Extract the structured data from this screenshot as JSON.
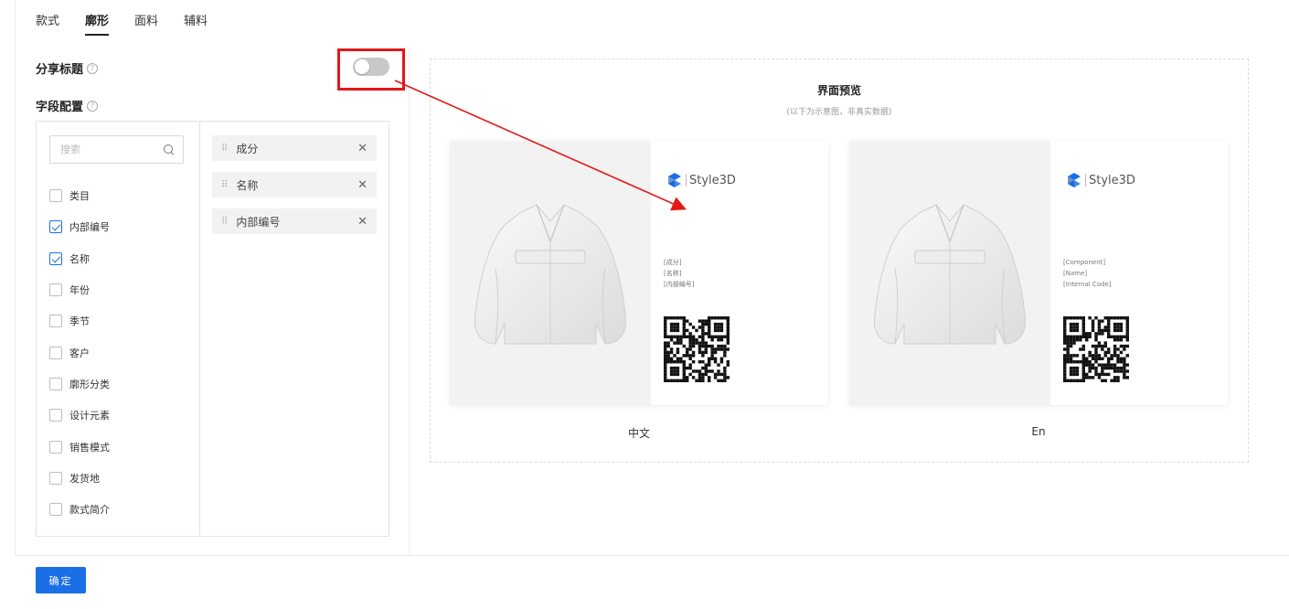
{
  "tabs": [
    {
      "label": "款式",
      "active": false
    },
    {
      "label": "廓形",
      "active": true
    },
    {
      "label": "面料",
      "active": false
    },
    {
      "label": "辅料",
      "active": false
    }
  ],
  "share_title": {
    "label": "分享标题",
    "enabled": false
  },
  "field_config": {
    "label": "字段配置"
  },
  "search": {
    "placeholder": "搜索",
    "value": ""
  },
  "fields": [
    {
      "label": "类目",
      "checked": false
    },
    {
      "label": "内部编号",
      "checked": true
    },
    {
      "label": "名称",
      "checked": true
    },
    {
      "label": "年份",
      "checked": false
    },
    {
      "label": "季节",
      "checked": false
    },
    {
      "label": "客户",
      "checked": false
    },
    {
      "label": "廓形分类",
      "checked": false
    },
    {
      "label": "设计元素",
      "checked": false
    },
    {
      "label": "销售模式",
      "checked": false
    },
    {
      "label": "发货地",
      "checked": false
    },
    {
      "label": "款式简介",
      "checked": false
    }
  ],
  "selected": [
    {
      "label": "成分"
    },
    {
      "label": "名称"
    },
    {
      "label": "内部编号"
    }
  ],
  "preview": {
    "title": "界面预览",
    "subtitle": "(以下为示意图，非真实数据)",
    "cards": [
      {
        "logo": "Style3D",
        "fields": [
          "[成分]",
          "[名称]",
          "[内部编号]"
        ],
        "caption": "中文"
      },
      {
        "logo": "Style3D",
        "fields": [
          "[Component]",
          "[Name]",
          "[Internal Code]"
        ],
        "caption": "En"
      }
    ]
  },
  "confirm_label": "确定",
  "colors": {
    "accent": "#1b6fe6",
    "highlight": "#e21818"
  },
  "icons": {
    "help": "question-circle-icon",
    "search": "search-icon",
    "drag": "drag-handle-icon",
    "remove": "close-icon",
    "logo": "style3d-logo-icon"
  }
}
